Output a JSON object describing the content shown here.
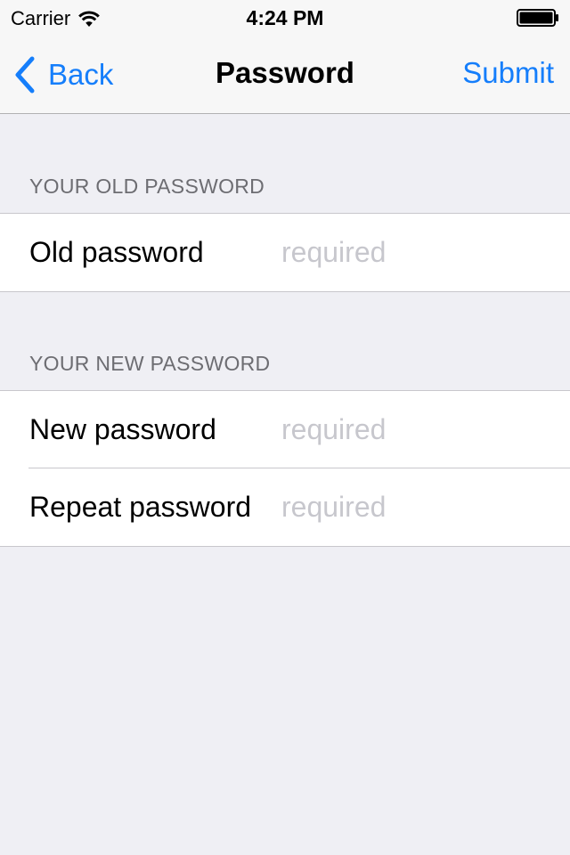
{
  "status_bar": {
    "carrier": "Carrier",
    "time": "4:24 PM"
  },
  "nav": {
    "back_label": "Back",
    "title": "Password",
    "submit_label": "Submit"
  },
  "sections": {
    "old": {
      "header": "YOUR OLD PASSWORD",
      "rows": [
        {
          "label": "Old password",
          "placeholder": "required",
          "value": ""
        }
      ]
    },
    "new": {
      "header": "YOUR NEW PASSWORD",
      "rows": [
        {
          "label": "New password",
          "placeholder": "required",
          "value": ""
        },
        {
          "label": "Repeat password",
          "placeholder": "required",
          "value": ""
        }
      ]
    }
  },
  "colors": {
    "accent": "#157efb",
    "background": "#efeff4",
    "bar_background": "#f7f7f7",
    "placeholder": "#c7c7cd",
    "section_header": "#6d6d72"
  },
  "icons": {
    "wifi": "wifi-icon",
    "battery": "battery-icon",
    "back": "chevron-left-icon"
  }
}
